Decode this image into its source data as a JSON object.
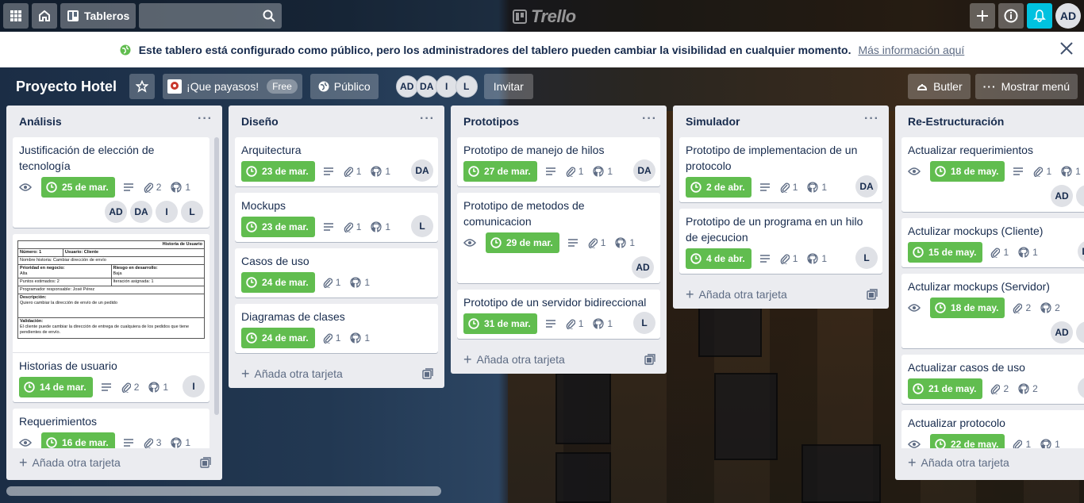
{
  "topbar": {
    "boards_label": "Tableros",
    "logo_text": "Trello",
    "user_initials": "AD"
  },
  "banner": {
    "message": "Este tablero está configurado como público, pero los administradores del tablero pueden cambiar la visibilidad en cualquier momento.",
    "link": "Más información aquí"
  },
  "board": {
    "title": "Proyecto Hotel",
    "team": "¡Que payasos!",
    "team_badge": "Free",
    "visibility": "Público",
    "members": [
      "AD",
      "DA",
      "I",
      "L"
    ],
    "invite": "Invitar",
    "butler": "Butler",
    "menu": "Mostrar menú"
  },
  "add_card_label": "Añada otra tarjeta",
  "cover_doc": {
    "header": "Historia de Usuario",
    "numero": "Número: 1",
    "usuario": "Usuario: Cliente",
    "nombre": "Nombre historia: Cambiar dirección de envío",
    "prioridad": "Prioridad en negocio:",
    "prioridad_val": "Alta",
    "riesgo": "Riesgo en desarrollo:",
    "riesgo_val": "Baja",
    "puntos": "Puntos estimados: 2",
    "iteracion": "Iteración asignada: 1",
    "programador": "Programador responsable: José Pérez",
    "descripcion": "Descripción:",
    "descripcion_val": "Quiero cambiar la dirección de envío de un pedido",
    "validacion": "Validación:",
    "validacion_val": "El cliente puede cambiar la dirección de entrega de cualquiera de los pedidos que tiene pendientes de envío."
  },
  "lists": [
    {
      "name": "Análisis",
      "cards": [
        {
          "title": "Justificación de elección de tecnología",
          "watch": true,
          "due": "25 de mar.",
          "desc": true,
          "attach": "2",
          "gh": "1",
          "members": [
            "AD",
            "DA",
            "I",
            "L"
          ],
          "members_inline": false
        },
        {
          "title": "Historias de usuario",
          "cover": true,
          "due": "14 de mar.",
          "desc": true,
          "attach": "2",
          "gh": "1",
          "members": [
            "I"
          ],
          "members_inline": true
        },
        {
          "title": "Requerimientos",
          "watch": true,
          "due": "16 de mar.",
          "desc": true,
          "attach": "3",
          "gh": "1",
          "members": [],
          "members_inline": true
        }
      ]
    },
    {
      "name": "Diseño",
      "cards": [
        {
          "title": "Arquitectura",
          "due": "23 de mar.",
          "desc": true,
          "attach": "1",
          "gh": "1",
          "members": [
            "DA"
          ],
          "members_inline": true
        },
        {
          "title": "Mockups",
          "due": "23 de mar.",
          "desc": true,
          "attach": "1",
          "gh": "1",
          "members": [
            "L"
          ],
          "members_inline": true
        },
        {
          "title": "Casos de uso",
          "due": "24 de mar.",
          "attach": "1",
          "gh": "1",
          "members": [],
          "members_inline": true
        },
        {
          "title": "Diagramas de clases",
          "due": "24 de mar.",
          "attach": "1",
          "gh": "1",
          "members": [],
          "members_inline": true
        }
      ]
    },
    {
      "name": "Prototipos",
      "cards": [
        {
          "title": "Prototipo de manejo de hilos",
          "due": "27 de mar.",
          "desc": true,
          "attach": "1",
          "gh": "1",
          "members": [
            "DA"
          ],
          "members_inline": true
        },
        {
          "title": "Prototipo de metodos de comunicacion",
          "watch": true,
          "due": "29 de mar.",
          "desc": true,
          "attach": "1",
          "gh": "1",
          "members": [
            "AD"
          ],
          "members_inline": false
        },
        {
          "title": "Prototipo de un servidor bidireccional",
          "due": "31 de mar.",
          "desc": true,
          "attach": "1",
          "gh": "1",
          "members": [
            "L"
          ],
          "members_inline": true
        }
      ]
    },
    {
      "name": "Simulador",
      "cards": [
        {
          "title": "Prototipo de implementacion de un protocolo",
          "due": "2 de abr.",
          "desc": true,
          "attach": "1",
          "gh": "1",
          "members": [
            "DA"
          ],
          "members_inline": true
        },
        {
          "title": "Prototipo de un programa en un hilo de ejecucion",
          "due": "4 de abr.",
          "desc": true,
          "attach": "1",
          "gh": "1",
          "members": [
            "L"
          ],
          "members_inline": true
        }
      ]
    },
    {
      "name": "Re-Estructuración",
      "cards": [
        {
          "title": "Actualizar requerimientos",
          "watch": true,
          "due": "18 de may.",
          "desc": true,
          "attach": "1",
          "gh": "1",
          "members": [
            "AD",
            "L"
          ],
          "members_inline": false
        },
        {
          "title": "Actulizar mockups (Cliente)",
          "due": "15 de may.",
          "attach": "1",
          "gh": "1",
          "members": [
            "DA"
          ],
          "members_inline": true
        },
        {
          "title": "Actulizar mockups (Servidor)",
          "watch": true,
          "due": "18 de may.",
          "attach": "2",
          "gh": "2",
          "members": [
            "AD",
            "L"
          ],
          "members_inline": false
        },
        {
          "title": "Actualizar casos de uso",
          "due": "21 de may.",
          "attach": "2",
          "gh": "2",
          "members": [
            "I"
          ],
          "members_inline": true
        },
        {
          "title": "Actualizar protocolo",
          "watch": true,
          "due": "22 de may.",
          "attach": "1",
          "gh": "1",
          "members": [],
          "members_inline": true
        }
      ]
    }
  ],
  "colors": {
    "due_green": "#61bd4f",
    "list_bg": "#ebecf0",
    "bell": "#00c2e0"
  }
}
